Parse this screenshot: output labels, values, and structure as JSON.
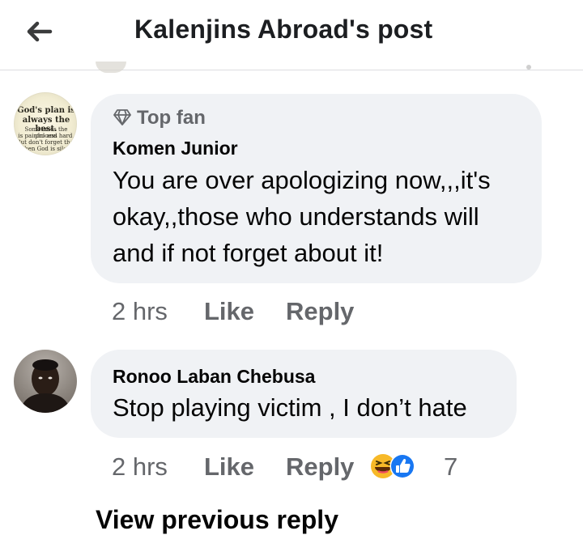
{
  "header": {
    "title": "Kalenjins Abroad's post",
    "back_icon": "arrow-left-icon"
  },
  "comments": [
    {
      "badge": "Top fan",
      "badge_icon": "diamond-icon",
      "author": "Komen Junior",
      "text_lines": [
        "You are over apologizing now,,,it's",
        "okay,,those who understands will",
        "and if not forget about it!"
      ],
      "avatar_text": [
        "God's plan is",
        "always the best.",
        "Sometimes the process",
        "is painful and hard.",
        "But don't forget that",
        "when God is silent"
      ],
      "time": "2 hrs",
      "like_label": "Like",
      "reply_label": "Reply"
    },
    {
      "author": "Ronoo Laban Chebusa",
      "text": "Stop playing victim , I don’t hate",
      "time": "2 hrs",
      "like_label": "Like",
      "reply_label": "Reply",
      "reactions": [
        "haha-icon",
        "like-icon"
      ],
      "reaction_count": "7"
    }
  ],
  "view_previous_label": "View previous reply",
  "colors": {
    "bubble": "#f0f2f5",
    "secondary_text": "#65676b",
    "like_blue": "#1877f2",
    "haha_yellow": "#f7b928"
  }
}
